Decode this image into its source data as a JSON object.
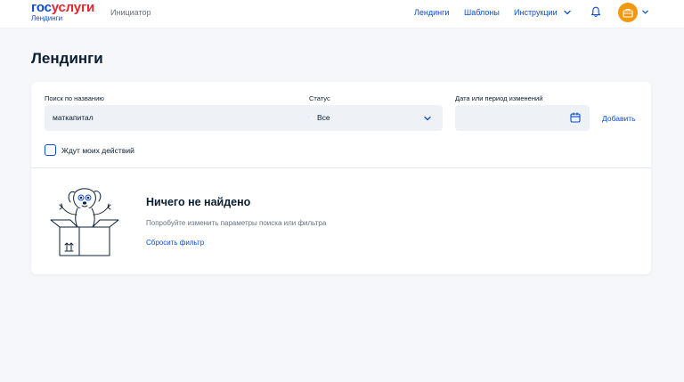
{
  "header": {
    "logo_part1": "гос",
    "logo_part2": "услуги",
    "logo_subtitle": "Лендинги",
    "role": "Инициатор",
    "nav": [
      "Лендинги",
      "Шаблоны",
      "Инструкции"
    ]
  },
  "page": {
    "title": "Лендинги"
  },
  "filters": {
    "search_label": "Поиск по названию",
    "search_value": "маткапитал",
    "status_label": "Статус",
    "status_value": "Все",
    "date_label": "Дата или период изменений",
    "date_value": "",
    "add_label": "Добавить",
    "checkbox_label": "Ждут моих действий",
    "checkbox_checked": false
  },
  "empty": {
    "title": "Ничего не найдено",
    "description": "Попробуйте изменить параметры поиска или фильтра",
    "reset_label": "Сбросить фильтр"
  },
  "colors": {
    "brand_blue": "#0d4cd3",
    "brand_red": "#e3262f",
    "avatar_orange": "#f2980c",
    "background": "#f5f7fb"
  },
  "icons": {
    "search": "search-icon",
    "dropdown": "chevron-down-icon",
    "calendar": "calendar-icon",
    "notifications": "bell-icon",
    "avatar": "briefcase-icon"
  }
}
